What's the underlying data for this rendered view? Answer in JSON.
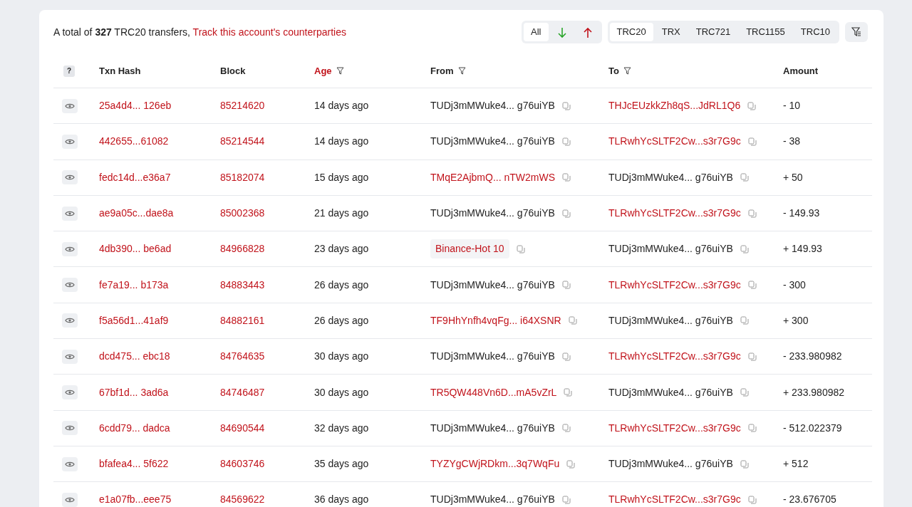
{
  "summary": {
    "text": "A total of **327** TRC20 transfers,",
    "link": "Track this account's counterparties"
  },
  "direction_filters": [
    {
      "kind": "all",
      "label": "All",
      "selected": true
    },
    {
      "kind": "in",
      "selected": false
    },
    {
      "kind": "out",
      "selected": false
    }
  ],
  "token_tabs": [
    {
      "label": "TRC20",
      "selected": true
    },
    {
      "label": "TRX",
      "selected": false
    },
    {
      "label": "TRC721",
      "selected": false
    },
    {
      "label": "TRC1155",
      "selected": false
    },
    {
      "label": "TRC10",
      "selected": false
    }
  ],
  "columns": [
    {
      "kind": "help",
      "label": "?"
    },
    {
      "kind": "text",
      "label": "Txn Hash",
      "active": false,
      "filter": false
    },
    {
      "kind": "text",
      "label": "Block",
      "active": false,
      "filter": false
    },
    {
      "kind": "text",
      "label": "Age",
      "active": true,
      "filter": true
    },
    {
      "kind": "text",
      "label": "From",
      "active": false,
      "filter": true
    },
    {
      "kind": "text",
      "label": "To",
      "active": false,
      "filter": true
    },
    {
      "kind": "text",
      "label": "Amount",
      "active": false,
      "filter": false
    }
  ],
  "rows": [
    {
      "hash": "25a4d4... 126eb",
      "block": "85214620",
      "age": "14 days ago",
      "from": {
        "kind": "self",
        "text": "TUDj3mMWuke4... g76uiYB"
      },
      "to": {
        "kind": "link",
        "text": "THJcEUzkkZh8qS...JdRL1Q6"
      },
      "amount": "- 10"
    },
    {
      "hash": "442655...61082",
      "block": "85214544",
      "age": "14 days ago",
      "from": {
        "kind": "self",
        "text": "TUDj3mMWuke4... g76uiYB"
      },
      "to": {
        "kind": "link",
        "text": "TLRwhYcSLTF2Cw...s3r7G9c"
      },
      "amount": "- 38"
    },
    {
      "hash": "fedc14d...e36a7",
      "block": "85182074",
      "age": "15 days ago",
      "from": {
        "kind": "link",
        "text": "TMqE2AjbmQ... nTW2mWS"
      },
      "to": {
        "kind": "self",
        "text": "TUDj3mMWuke4... g76uiYB"
      },
      "amount": "+ 50"
    },
    {
      "hash": "ae9a05c...dae8a",
      "block": "85002368",
      "age": "21 days ago",
      "from": {
        "kind": "self",
        "text": "TUDj3mMWuke4... g76uiYB"
      },
      "to": {
        "kind": "link",
        "text": "TLRwhYcSLTF2Cw...s3r7G9c"
      },
      "amount": "- 149.93"
    },
    {
      "hash": "4db390... be6ad",
      "block": "84966828",
      "age": "23 days ago",
      "from": {
        "kind": "tag",
        "text": "Binance-Hot 10"
      },
      "to": {
        "kind": "self",
        "text": "TUDj3mMWuke4... g76uiYB"
      },
      "amount": "+ 149.93"
    },
    {
      "hash": "fe7a19... b173a",
      "block": "84883443",
      "age": "26 days ago",
      "from": {
        "kind": "self",
        "text": "TUDj3mMWuke4... g76uiYB"
      },
      "to": {
        "kind": "link",
        "text": "TLRwhYcSLTF2Cw...s3r7G9c"
      },
      "amount": "- 300"
    },
    {
      "hash": "f5a56d1...41af9",
      "block": "84882161",
      "age": "26 days ago",
      "from": {
        "kind": "link",
        "text": "TF9HhYnfh4vqFg... i64XSNR"
      },
      "to": {
        "kind": "self",
        "text": "TUDj3mMWuke4... g76uiYB"
      },
      "amount": "+ 300"
    },
    {
      "hash": "dcd475... ebc18",
      "block": "84764635",
      "age": "30 days ago",
      "from": {
        "kind": "self",
        "text": "TUDj3mMWuke4... g76uiYB"
      },
      "to": {
        "kind": "link",
        "text": "TLRwhYcSLTF2Cw...s3r7G9c"
      },
      "amount": "- 233.980982"
    },
    {
      "hash": "67bf1d... 3ad6a",
      "block": "84746487",
      "age": "30 days ago",
      "from": {
        "kind": "link",
        "text": "TR5QW448Vn6D...mA5vZrL"
      },
      "to": {
        "kind": "self",
        "text": "TUDj3mMWuke4... g76uiYB"
      },
      "amount": "+ 233.980982"
    },
    {
      "hash": "6cdd79... dadca",
      "block": "84690544",
      "age": "32 days ago",
      "from": {
        "kind": "self",
        "text": "TUDj3mMWuke4... g76uiYB"
      },
      "to": {
        "kind": "link",
        "text": "TLRwhYcSLTF2Cw...s3r7G9c"
      },
      "amount": "- 512.022379"
    },
    {
      "hash": "bfafea4... 5f622",
      "block": "84603746",
      "age": "35 days ago",
      "from": {
        "kind": "link",
        "text": "TYZYgCWjRDkm...3q7WqFu"
      },
      "to": {
        "kind": "self",
        "text": "TUDj3mMWuke4... g76uiYB"
      },
      "amount": "+ 512"
    },
    {
      "hash": "e1a07fb...eee75",
      "block": "84569622",
      "age": "36 days ago",
      "from": {
        "kind": "self",
        "text": "TUDj3mMWuke4... g76uiYB"
      },
      "to": {
        "kind": "link",
        "text": "TLRwhYcSLTF2Cw...s3r7G9c"
      },
      "amount": "- 23.676705"
    }
  ]
}
